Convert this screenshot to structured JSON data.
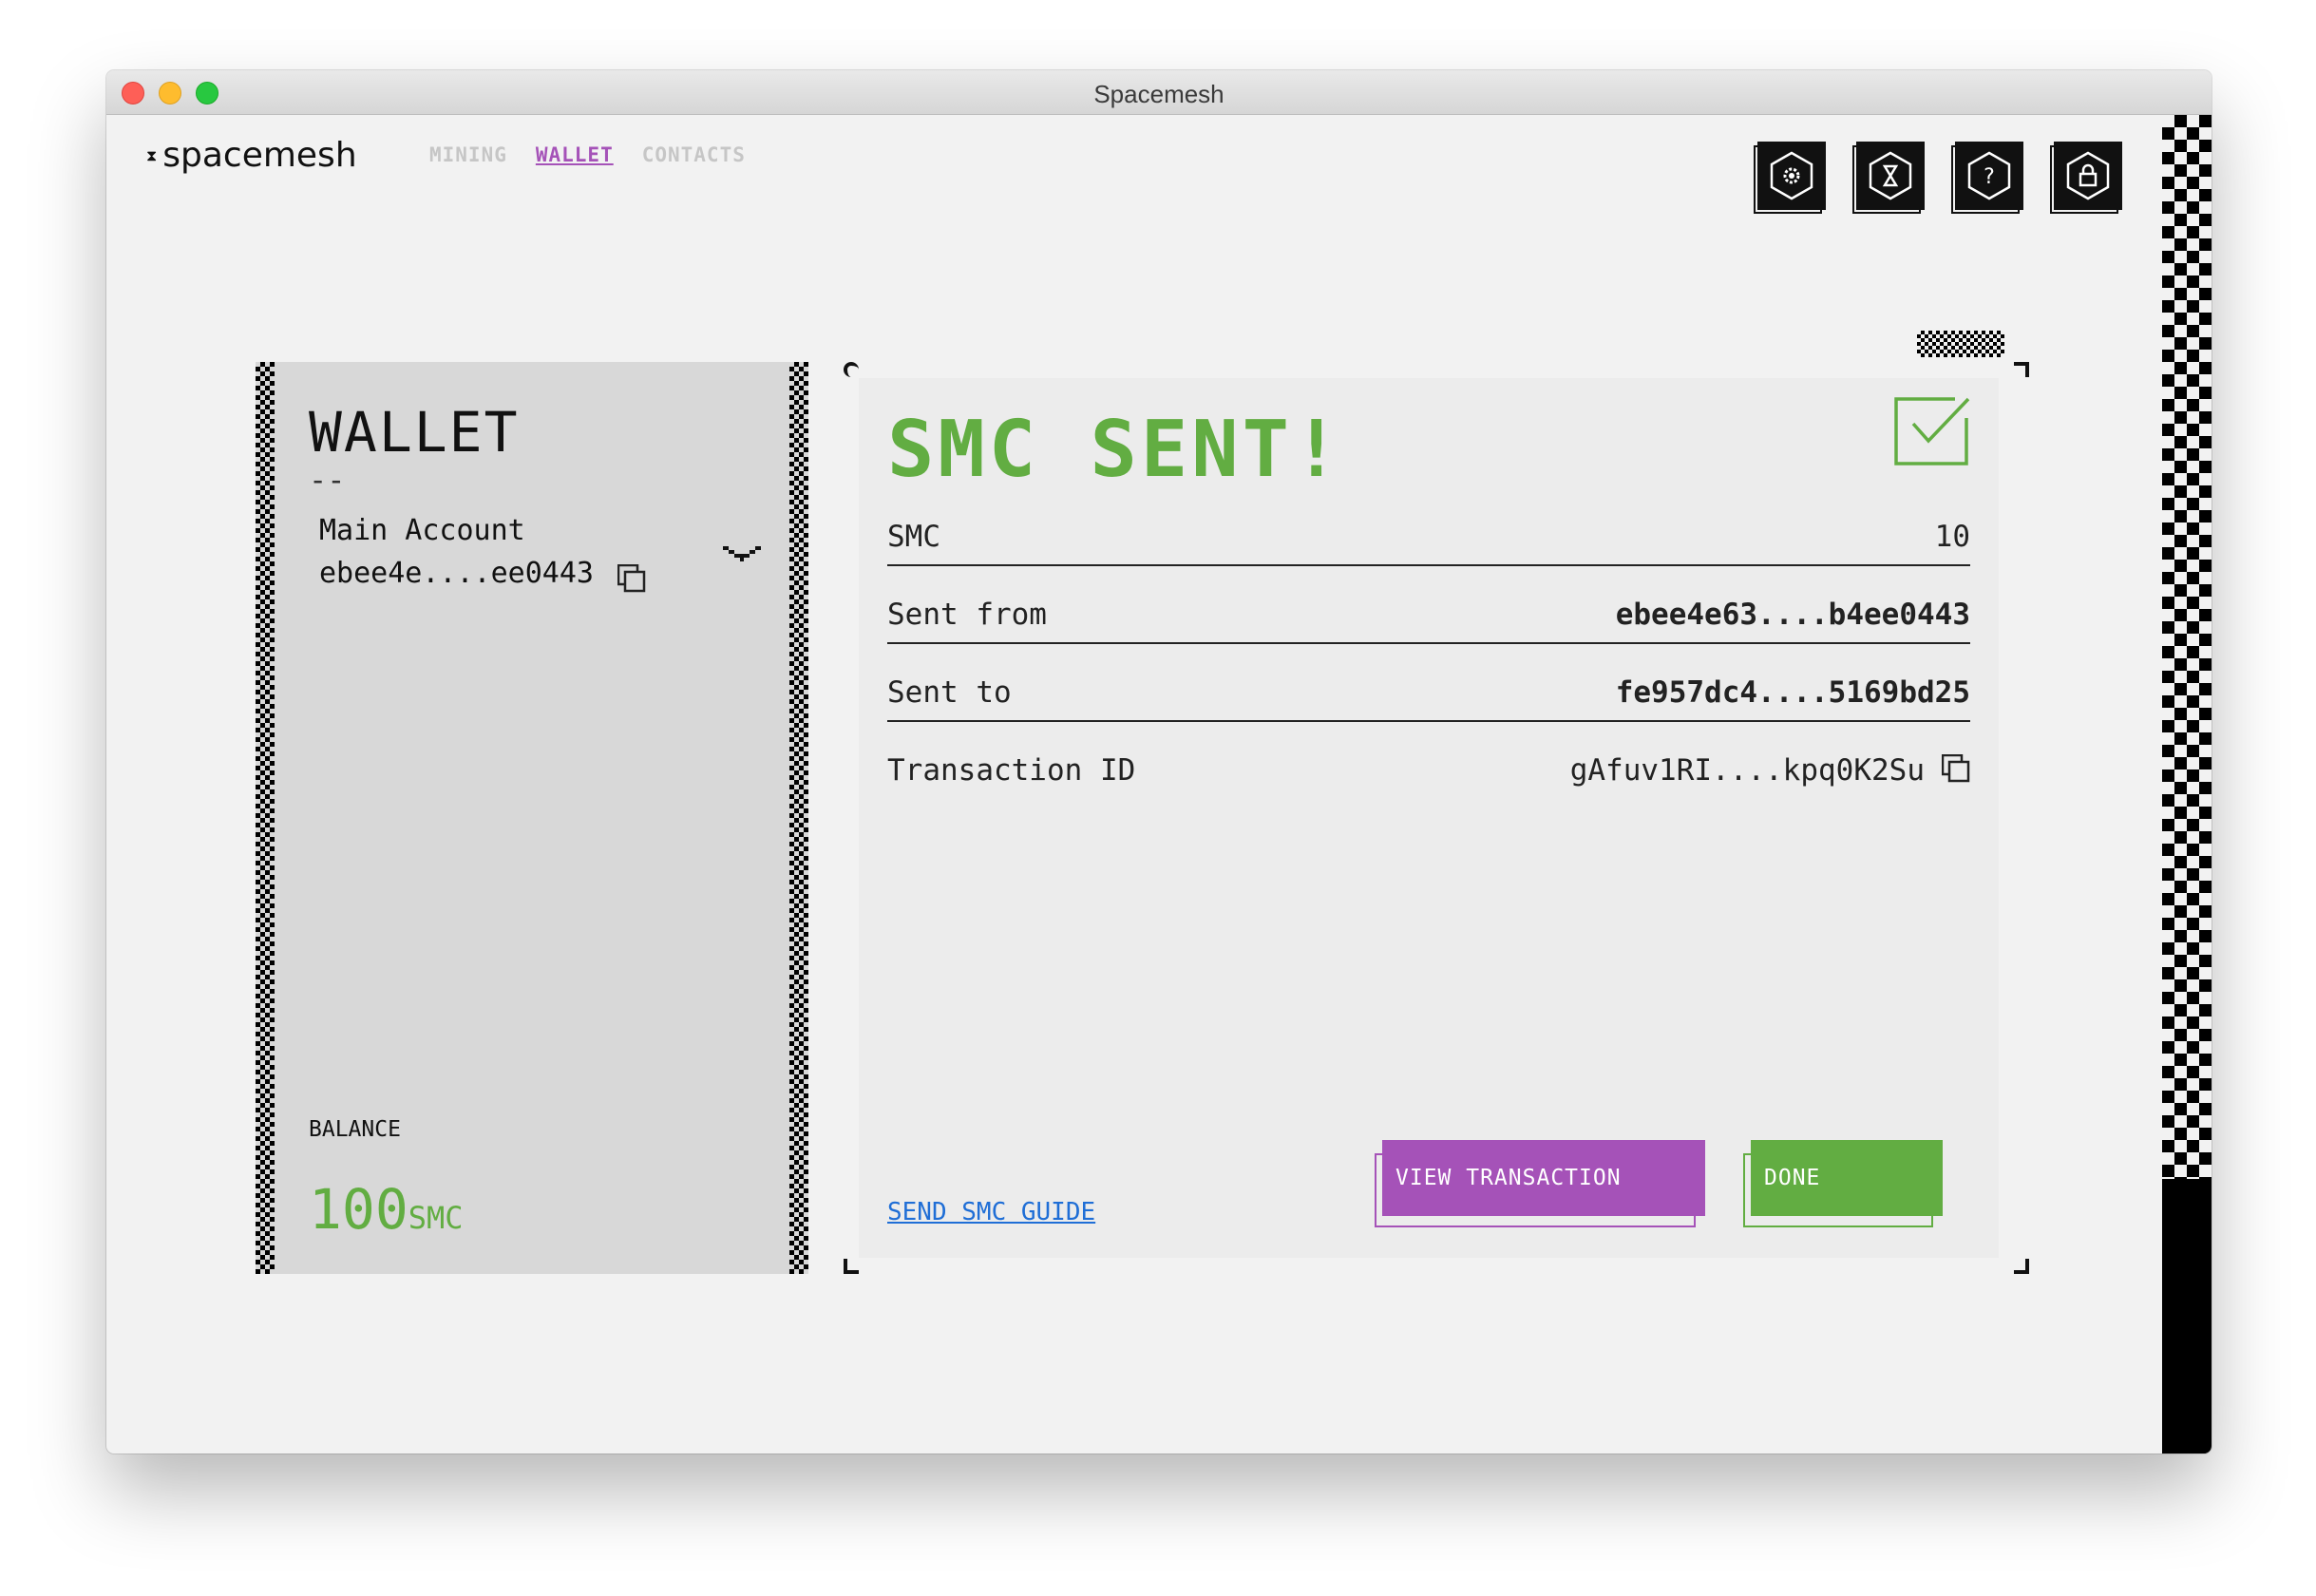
{
  "window": {
    "title": "Spacemesh"
  },
  "header": {
    "logo_mark": "⧗",
    "logo_text": "spacemesh",
    "nav": [
      {
        "label": "MINING",
        "active": false
      },
      {
        "label": "WALLET",
        "active": true
      },
      {
        "label": "CONTACTS",
        "active": false
      }
    ],
    "icons": [
      "settings-icon",
      "hourglass-icon",
      "help-icon",
      "lock-icon"
    ]
  },
  "wallet": {
    "title": "WALLET",
    "dash": "--",
    "account_name": "Main Account",
    "account_address": "ebee4e....ee0443",
    "balance_label": "BALANCE",
    "balance_amount": "100",
    "balance_unit": "SMC"
  },
  "sent": {
    "title": "SMC SENT!",
    "rows": [
      {
        "label": "SMC",
        "value": "10"
      },
      {
        "label": "Sent from",
        "value": "ebee4e63....b4ee0443"
      },
      {
        "label": "Sent to",
        "value": "fe957dc4....5169bd25"
      },
      {
        "label": "Transaction ID",
        "value": "gAfuv1RI....kpq0K2Su"
      }
    ],
    "guide_link": "SEND SMC GUIDE",
    "view_button": "VIEW TRANSACTION",
    "done_button": "DONE"
  },
  "colors": {
    "accent_green": "#62ad42",
    "accent_purple": "#a552b8",
    "link_blue": "#1f6ed6"
  }
}
